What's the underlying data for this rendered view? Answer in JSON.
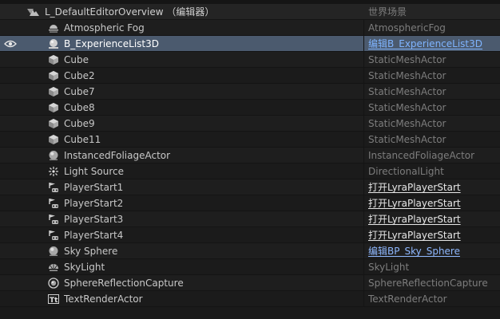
{
  "outliner": {
    "header": {
      "name": "L_DefaultEditorOverview （编辑器）",
      "type": "世界场景"
    },
    "rows": [
      {
        "name": "Atmospheric Fog",
        "type": "AtmosphericFog",
        "icon": "atmospheric-fog-icon",
        "type_style": "plain"
      },
      {
        "name": "B_ExperienceList3D",
        "type": "编辑B_ExperienceList3D",
        "icon": "blueprint-sphere-icon",
        "type_style": "link",
        "selected": true,
        "visible_eye": true
      },
      {
        "name": "Cube",
        "type": "StaticMeshActor",
        "icon": "static-mesh-icon",
        "type_style": "plain"
      },
      {
        "name": "Cube2",
        "type": "StaticMeshActor",
        "icon": "static-mesh-icon",
        "type_style": "plain"
      },
      {
        "name": "Cube7",
        "type": "StaticMeshActor",
        "icon": "static-mesh-icon",
        "type_style": "plain"
      },
      {
        "name": "Cube8",
        "type": "StaticMeshActor",
        "icon": "static-mesh-icon",
        "type_style": "plain"
      },
      {
        "name": "Cube9",
        "type": "StaticMeshActor",
        "icon": "static-mesh-icon",
        "type_style": "plain"
      },
      {
        "name": "Cube11",
        "type": "StaticMeshActor",
        "icon": "static-mesh-icon",
        "type_style": "plain"
      },
      {
        "name": "InstancedFoliageActor",
        "type": "InstancedFoliageActor",
        "icon": "actor-sphere-icon",
        "type_style": "plain"
      },
      {
        "name": "Light Source",
        "type": "DirectionalLight",
        "icon": "directional-light-icon",
        "type_style": "plain"
      },
      {
        "name": "PlayerStart1",
        "type": "打开LyraPlayerStart",
        "icon": "player-start-icon",
        "type_style": "link"
      },
      {
        "name": "PlayerStart2",
        "type": "打开LyraPlayerStart",
        "icon": "player-start-icon",
        "type_style": "link"
      },
      {
        "name": "PlayerStart3",
        "type": "打开LyraPlayerStart",
        "icon": "player-start-icon",
        "type_style": "link"
      },
      {
        "name": "PlayerStart4",
        "type": "打开LyraPlayerStart",
        "icon": "player-start-icon",
        "type_style": "link"
      },
      {
        "name": "Sky Sphere",
        "type": "编辑BP_Sky_Sphere",
        "icon": "actor-sphere-icon",
        "type_style": "link-blue"
      },
      {
        "name": "SkyLight",
        "type": "SkyLight",
        "icon": "sky-light-icon",
        "type_style": "plain"
      },
      {
        "name": "SphereReflectionCapture",
        "type": "SphereReflectionCapture",
        "icon": "reflection-capture-icon",
        "type_style": "plain"
      },
      {
        "name": "TextRenderActor",
        "type": "TextRenderActor",
        "icon": "text-render-icon",
        "type_style": "plain"
      }
    ]
  }
}
